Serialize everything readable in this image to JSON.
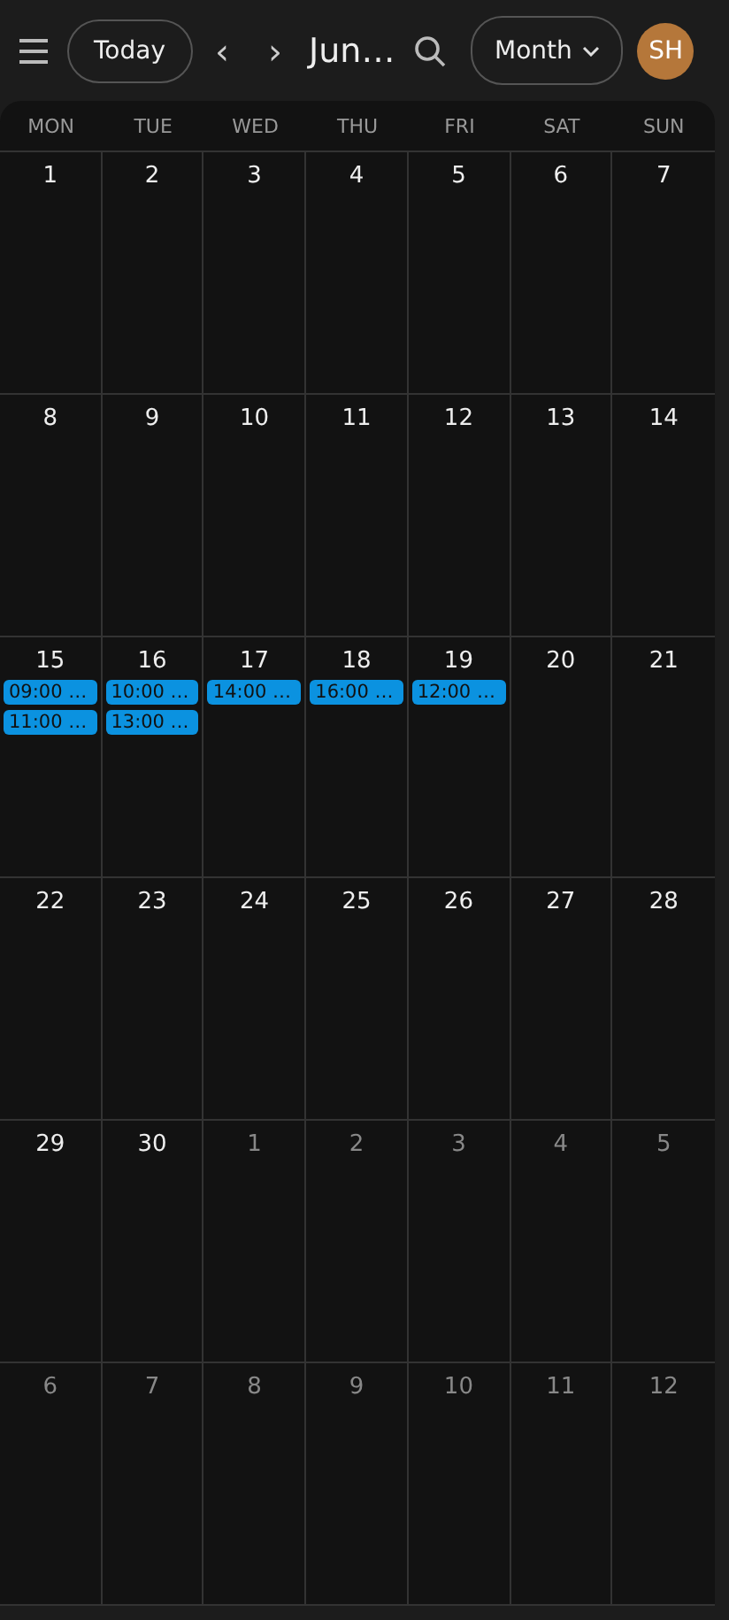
{
  "toolbar": {
    "today": "Today",
    "prev": "‹",
    "next": "›",
    "title": "Jun…",
    "view": "Month",
    "avatar": "SH"
  },
  "weekdays": [
    "MON",
    "TUE",
    "WED",
    "THU",
    "FRI",
    "SAT",
    "SUN"
  ],
  "weeks": [
    [
      {
        "day": "1",
        "in_month": true
      },
      {
        "day": "2",
        "in_month": true
      },
      {
        "day": "3",
        "in_month": true
      },
      {
        "day": "4",
        "in_month": true
      },
      {
        "day": "5",
        "in_month": true
      },
      {
        "day": "6",
        "in_month": true
      },
      {
        "day": "7",
        "in_month": true
      }
    ],
    [
      {
        "day": "8",
        "in_month": true
      },
      {
        "day": "9",
        "in_month": true
      },
      {
        "day": "10",
        "in_month": true
      },
      {
        "day": "11",
        "in_month": true
      },
      {
        "day": "12",
        "in_month": true
      },
      {
        "day": "13",
        "in_month": true
      },
      {
        "day": "14",
        "in_month": true
      }
    ],
    [
      {
        "day": "15",
        "in_month": true,
        "events": [
          "09:00 …",
          "11:00 …"
        ]
      },
      {
        "day": "16",
        "in_month": true,
        "events": [
          "10:00 …",
          "13:00 …"
        ]
      },
      {
        "day": "17",
        "in_month": true,
        "events": [
          "14:00 …"
        ]
      },
      {
        "day": "18",
        "in_month": true,
        "events": [
          "16:00 …"
        ]
      },
      {
        "day": "19",
        "in_month": true,
        "events": [
          "12:00 …"
        ]
      },
      {
        "day": "20",
        "in_month": true
      },
      {
        "day": "21",
        "in_month": true
      }
    ],
    [
      {
        "day": "22",
        "in_month": true
      },
      {
        "day": "23",
        "in_month": true
      },
      {
        "day": "24",
        "in_month": true
      },
      {
        "day": "25",
        "in_month": true
      },
      {
        "day": "26",
        "in_month": true
      },
      {
        "day": "27",
        "in_month": true
      },
      {
        "day": "28",
        "in_month": true
      }
    ],
    [
      {
        "day": "29",
        "in_month": true
      },
      {
        "day": "30",
        "in_month": true
      },
      {
        "day": "1",
        "in_month": false
      },
      {
        "day": "2",
        "in_month": false
      },
      {
        "day": "3",
        "in_month": false
      },
      {
        "day": "4",
        "in_month": false
      },
      {
        "day": "5",
        "in_month": false
      }
    ],
    [
      {
        "day": "6",
        "in_month": false
      },
      {
        "day": "7",
        "in_month": false
      },
      {
        "day": "8",
        "in_month": false
      },
      {
        "day": "9",
        "in_month": false
      },
      {
        "day": "10",
        "in_month": false
      },
      {
        "day": "11",
        "in_month": false
      },
      {
        "day": "12",
        "in_month": false
      }
    ]
  ]
}
